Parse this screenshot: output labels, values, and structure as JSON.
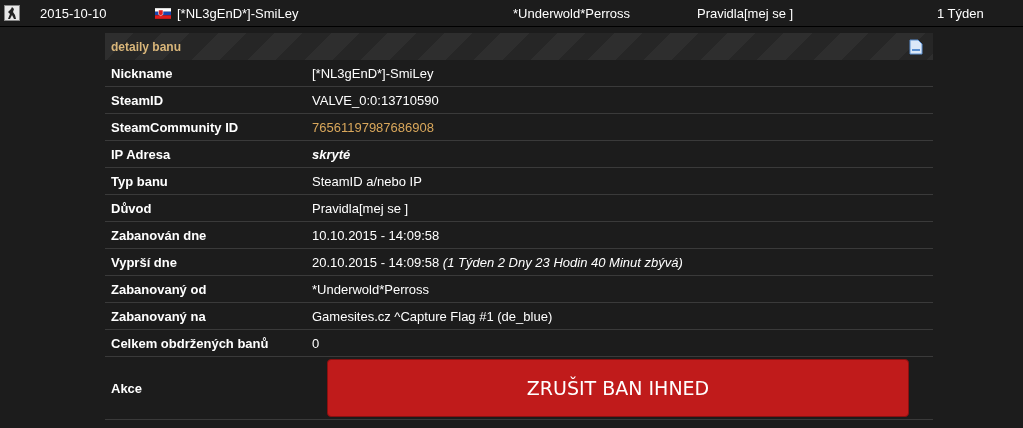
{
  "ban_row": {
    "date": "2015-10-10",
    "nickname": "[*NL3gEnD*]-SmiLey",
    "admin": "*Underwold*Perross",
    "reason": "Pravidla[mej se ]",
    "length": "1 Týden"
  },
  "details": {
    "title": "detaily banu",
    "rows": [
      {
        "label": "Nickname",
        "value": "[*NL3gEnD*]-SmiLey",
        "kind": "text"
      },
      {
        "label": "SteamID",
        "value": "VALVE_0:0:13710590",
        "kind": "text"
      },
      {
        "label": "SteamCommunity ID",
        "value": "76561197987686908",
        "kind": "link"
      },
      {
        "label": "IP Adresa",
        "value": "skryté",
        "kind": "hidden"
      },
      {
        "label": "Typ banu",
        "value": "SteamID a/nebo IP",
        "kind": "text"
      },
      {
        "label": "Důvod",
        "value": "Pravidla[mej se ]",
        "kind": "text"
      },
      {
        "label": "Zabanován dne",
        "value": "10.10.2015 - 14:09:58",
        "kind": "text"
      },
      {
        "label": "Vyprší dne",
        "value": "20.10.2015 - 14:09:58",
        "note": "(1 Týden 2 Dny 23 Hodin 40 Minut zbývá)",
        "kind": "text"
      },
      {
        "label": "Zabanovaný od",
        "value": "*Underwold*Perross",
        "kind": "text"
      },
      {
        "label": "Zabanovaný na",
        "value": "Gamesites.cz ^Capture Flag #1 (de_blue)",
        "kind": "text"
      },
      {
        "label": "Celkem obdržených banů",
        "value": "0",
        "kind": "text"
      }
    ],
    "action": {
      "label": "Akce",
      "button": "ZRUŠIT BAN IHNED"
    }
  }
}
